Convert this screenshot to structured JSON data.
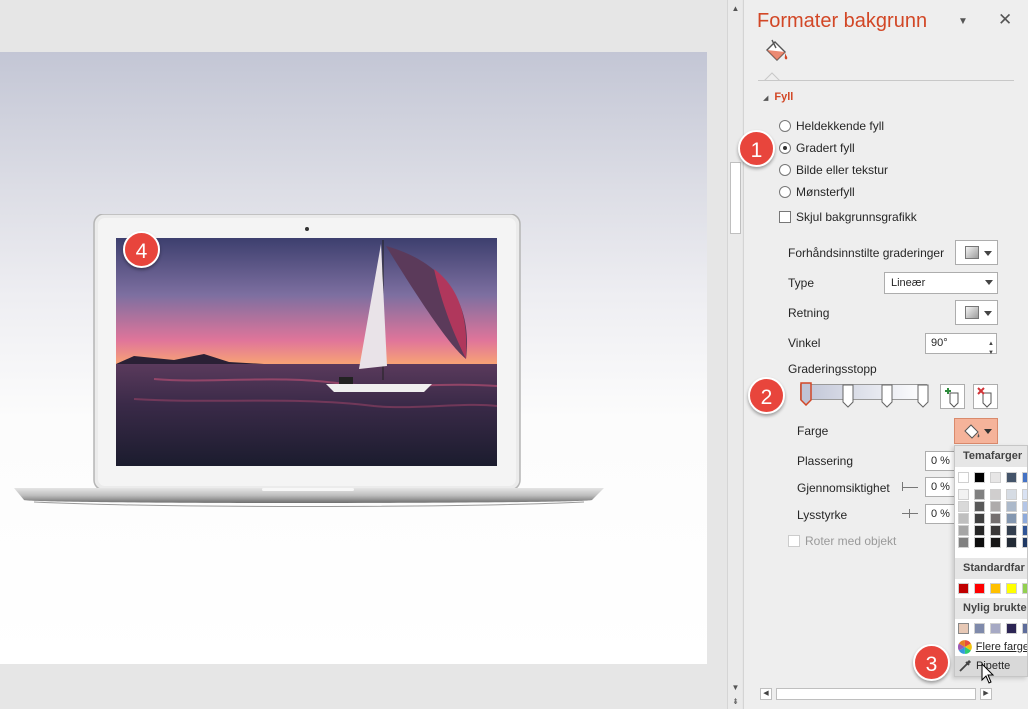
{
  "pane": {
    "title": "Formater bakgrunn",
    "section": "Fyll",
    "fill_options": [
      {
        "label": "Heldekkende fyll",
        "selected": false
      },
      {
        "label": "Gradert fyll",
        "selected": true
      },
      {
        "label": "Bilde eller tekstur",
        "selected": false
      },
      {
        "label": "Mønsterfyll",
        "selected": false
      }
    ],
    "hide_background_graphics": "Skjul bakgrunnsgrafikk",
    "preset_gradients_label": "Forhåndsinnstilte graderinger",
    "type_label": "Type",
    "type_value": "Lineær",
    "direction_label": "Retning",
    "angle_label": "Vinkel",
    "angle_value": "90°",
    "gradient_stops_label": "Graderingsstopp",
    "color_label": "Farge",
    "position_label": "Plassering",
    "position_value": "0 %",
    "transparency_label": "Gjennomsiktighet",
    "transparency_value": "0 %",
    "brightness_label": "Lysstyrke",
    "brightness_value": "0 %",
    "rotate_with_shape_label": "Roter med objekt"
  },
  "color_menu": {
    "theme_colors_header": "Temafarger",
    "standard_colors_header": "Standardfar",
    "recent_colors_header": "Nylig brukte",
    "more_colors": "Flere farge",
    "eyedropper": "Pipette",
    "theme_top": [
      "#ffffff",
      "#000000",
      "#e7e6e6",
      "#44546a",
      "#4472c4"
    ],
    "theme_shades": [
      [
        "#f2f2f2",
        "#808080",
        "#d0cece",
        "#d6dce4",
        "#d9e2f3"
      ],
      [
        "#d9d9d9",
        "#595959",
        "#aeabab",
        "#acb9ca",
        "#b4c6e7"
      ],
      [
        "#bfbfbf",
        "#404040",
        "#757070",
        "#8497b0",
        "#8eaadb"
      ],
      [
        "#a6a6a6",
        "#262626",
        "#3a3838",
        "#333f4f",
        "#2f5496"
      ],
      [
        "#808080",
        "#0d0d0d",
        "#171616",
        "#222a35",
        "#1f3864"
      ]
    ],
    "standard": [
      "#c00000",
      "#ff0000",
      "#ffc000",
      "#ffff00",
      "#92d050"
    ],
    "recent": [
      "#e7c8b5",
      "#7f8aab",
      "#a6a9c4",
      "#2c2554",
      "#5d6c9a"
    ]
  },
  "badges": [
    "1",
    "2",
    "3",
    "4"
  ],
  "colors": {
    "accent": "#d24726",
    "badge": "#e8453c"
  }
}
